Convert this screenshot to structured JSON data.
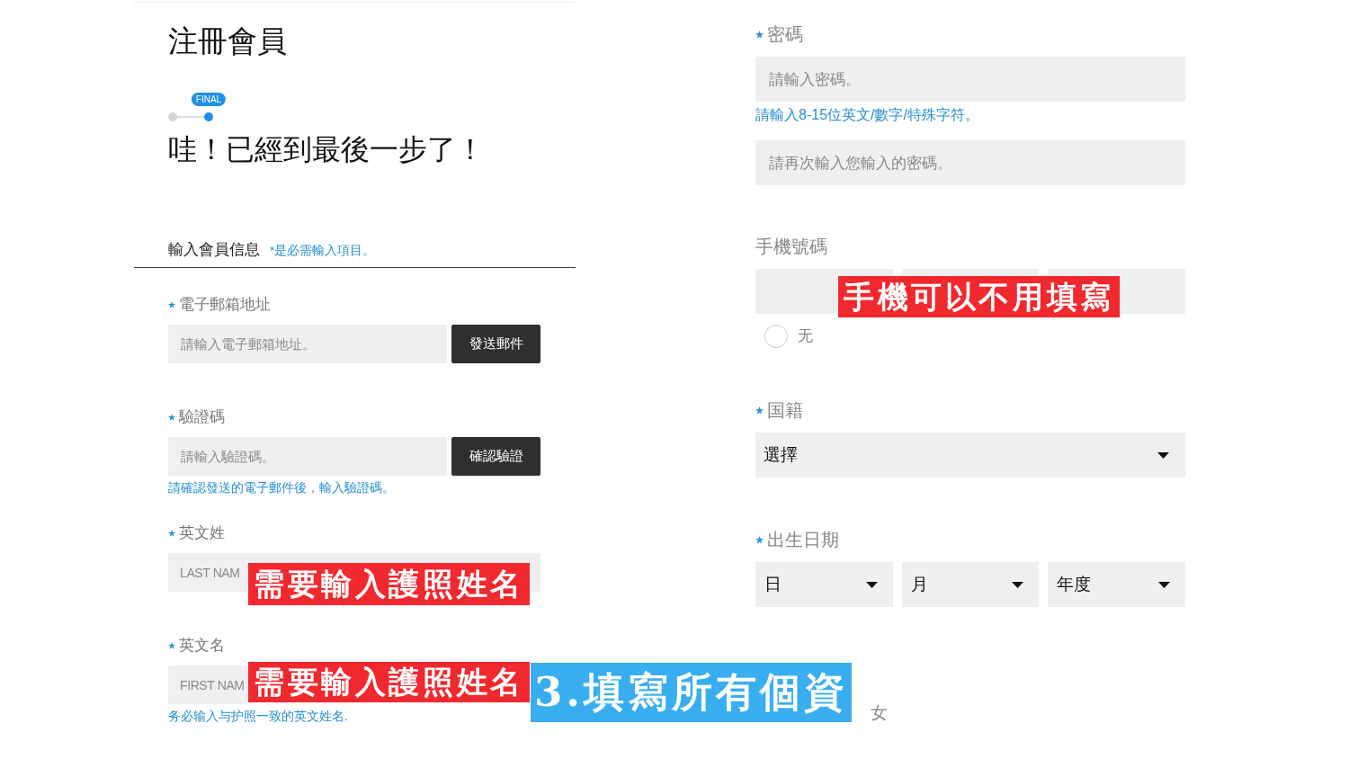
{
  "header": {
    "title": "注冊會員",
    "steps": [
      {
        "selected": false
      },
      {
        "selected": true,
        "badge": "FINAL"
      }
    ],
    "heading": "哇！已經到最後一步了！"
  },
  "section": {
    "title": "輸入會員信息",
    "note": "*是必需輸入項目。"
  },
  "left_fields": [
    {
      "kind": "input_button",
      "label": "電子郵箱地址",
      "required": true,
      "placeholder": "請輸入電子郵箱地址。",
      "button": "發送郵件"
    },
    {
      "kind": "input_button",
      "label": "驗證碼",
      "required": true,
      "placeholder": "請輸入驗證碼。",
      "button": "確認驗證",
      "help": "請確認發送的電子郵件後，輸入驗證碼。"
    },
    {
      "kind": "input",
      "label": "英文姓",
      "required": true,
      "placeholder": "LAST NAM"
    },
    {
      "kind": "input",
      "label": "英文名",
      "required": true,
      "placeholder": "FIRST NAM",
      "help": "务必输入与护照一致的英文姓名."
    }
  ],
  "right_fields": [
    {
      "kind": "password",
      "label": "密碼",
      "required": true,
      "placeholder": "請輸入密碼。",
      "help": "請輸入8-15位英文/數字/特殊字符。",
      "confirm_placeholder": "請再次輸入您輸入的密碼。"
    },
    {
      "kind": "phone",
      "label": "手機號碼",
      "option": {
        "label": "无",
        "selected": false
      }
    },
    {
      "kind": "select",
      "label": "国籍",
      "required": true,
      "value": "選擇"
    },
    {
      "kind": "date",
      "label": "出生日期",
      "required": true,
      "selects": [
        "日",
        "月",
        "年度"
      ]
    },
    {
      "kind": "option_labels",
      "labels": [
        "女"
      ]
    }
  ],
  "captions": [
    {
      "text": "需要輸入護照姓名",
      "color": "#f1282d"
    },
    {
      "text": "需要輸入護照姓名",
      "color": "#f1282d"
    },
    {
      "text": "手機可以不用填寫",
      "color": "#f1282d"
    },
    {
      "text": "3.填寫所有個資",
      "color": "#38aef0"
    }
  ]
}
